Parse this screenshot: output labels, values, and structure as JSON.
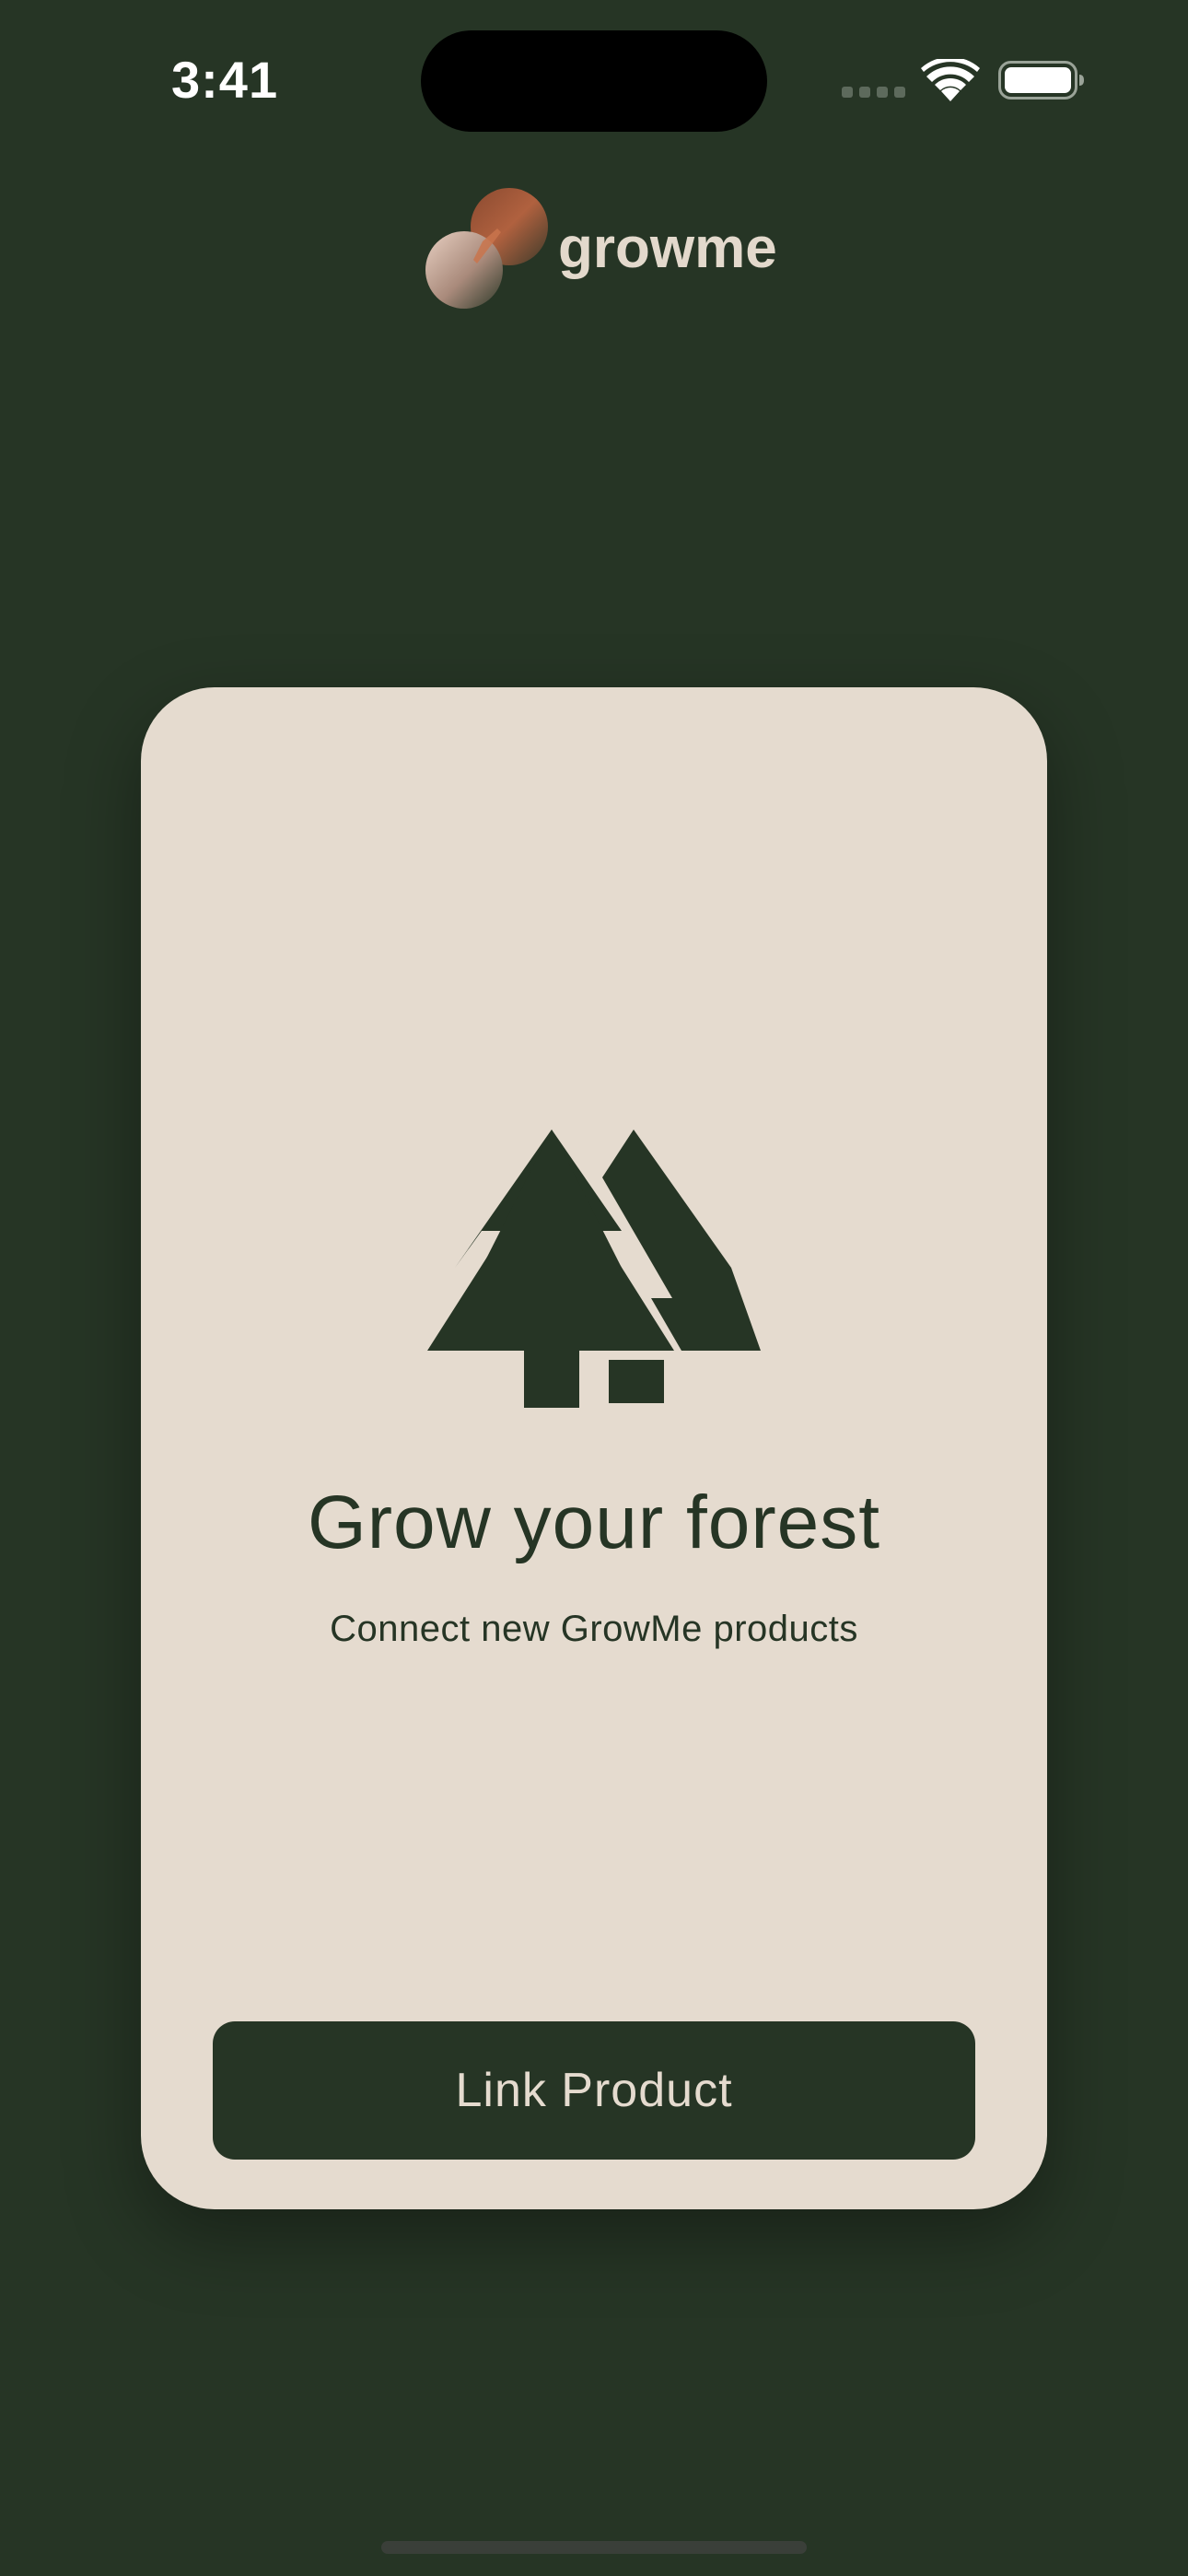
{
  "status_bar": {
    "time": "3:41",
    "icons": [
      "cellular-signal-icon",
      "wifi-icon",
      "battery-icon"
    ]
  },
  "brand": {
    "name": "growme",
    "logo_icon": "growme-logo-icon"
  },
  "card": {
    "icon": "trees-icon",
    "title": "Grow your forest",
    "subtitle": "Connect new GrowMe products",
    "button_label": "Link Product"
  },
  "colors": {
    "background": "#263525",
    "card": "#e5dbcf",
    "accent_copper": "#a0573a",
    "text_light": "#e3d9cc"
  }
}
